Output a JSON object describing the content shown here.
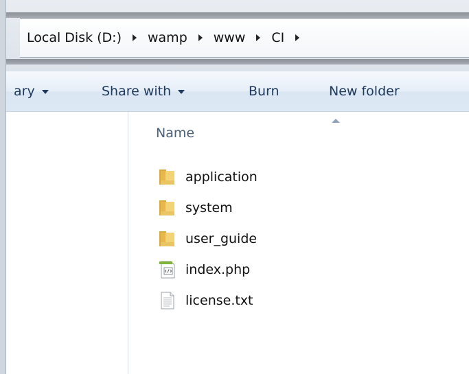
{
  "breadcrumb": {
    "items": [
      "Local Disk (D:)",
      "wamp",
      "www",
      "CI"
    ]
  },
  "toolbar": {
    "library_label": "ary",
    "share_label": "Share with",
    "burn_label": "Burn",
    "new_folder_label": "New folder"
  },
  "columns": {
    "name_label": "Name"
  },
  "files": [
    {
      "name": "application",
      "icon": "folder-icon"
    },
    {
      "name": "system",
      "icon": "folder-icon"
    },
    {
      "name": "user_guide",
      "icon": "folder-icon"
    },
    {
      "name": "index.php",
      "icon": "php-file-icon"
    },
    {
      "name": "license.txt",
      "icon": "text-file-icon"
    }
  ],
  "colors": {
    "toolbar_text": "#1e395b",
    "folder": "#e8c15a",
    "php_green": "#7fb33c"
  }
}
